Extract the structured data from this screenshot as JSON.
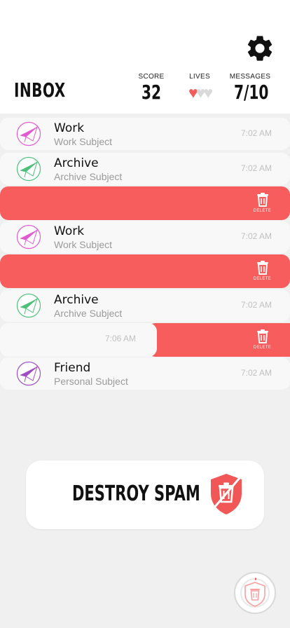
{
  "header": {
    "title": "INBOX",
    "score_label": "SCORE",
    "score": "32",
    "lives_label": "LIVES",
    "lives": 1,
    "lives_max": 3,
    "messages_label": "MESSAGES",
    "messages": "7/10"
  },
  "emails": [
    {
      "sender": "Work",
      "subject": "Work Subject",
      "time": "7:02 AM",
      "color": "#e25ad1"
    },
    {
      "sender": "Archive",
      "subject": "Archive Subject",
      "time": "7:02 AM",
      "color": "#4fbf7c"
    },
    {
      "sender": "Work",
      "subject": "Work Subject",
      "time": "7:02 AM",
      "color": "#e25ad1"
    },
    {
      "sender": "Archive",
      "subject": "Archive Subject",
      "time": "7:02 AM",
      "color": "#4fbf7c"
    },
    {
      "sender": "Friend",
      "subject": "Personal Subject",
      "time": "7:02 AM",
      "color": "#a24cc4"
    }
  ],
  "swiped_row": {
    "time": "7:06 AM"
  },
  "delete_label": "DELETE",
  "destroy_button": {
    "label": "DESTROY SPAM"
  },
  "colors": {
    "accent": "#f85d5d",
    "heart_on": "#f25c5c",
    "heart_off": "#d9d9d9"
  },
  "icons": {
    "settings": "gear-icon",
    "delete": "trash-icon",
    "destroy": "shield-trash-icon",
    "avatar": "envelope-plane-icon"
  }
}
